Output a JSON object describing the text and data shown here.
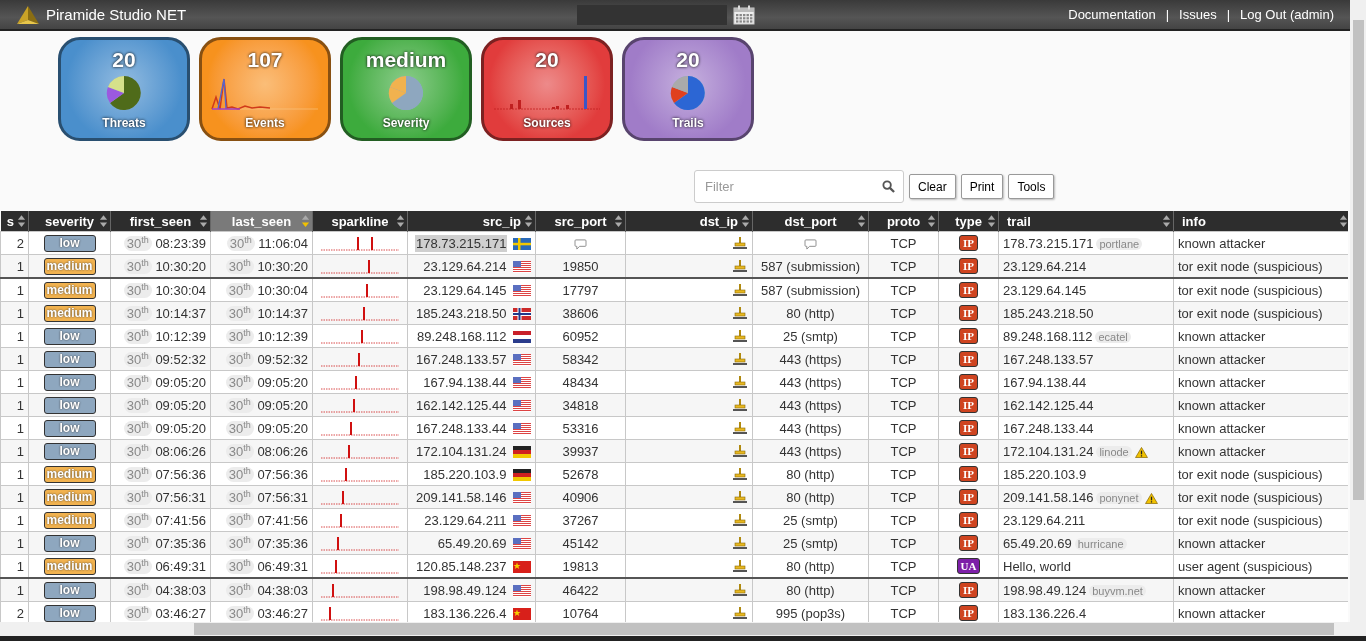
{
  "header": {
    "title": "Piramide Studio NET",
    "links": [
      "Documentation",
      "Issues",
      "Log Out (admin)"
    ],
    "separators": [
      "|",
      "|"
    ]
  },
  "cards": [
    {
      "value": "20",
      "label": "Threats",
      "color": "#4a8fcc",
      "kind": "pie"
    },
    {
      "value": "107",
      "label": "Events",
      "color": "#f7921e",
      "kind": "line"
    },
    {
      "value": "medium",
      "label": "Severity",
      "color": "#3dab3d",
      "kind": "pie"
    },
    {
      "value": "20",
      "label": "Sources",
      "color": "#e13c3c",
      "kind": "bar"
    },
    {
      "value": "20",
      "label": "Trails",
      "color": "#a07cc8",
      "kind": "pie"
    }
  ],
  "filter": {
    "placeholder": "Filter"
  },
  "buttons": [
    "Clear",
    "Print",
    "Tools"
  ],
  "table": {
    "columns": [
      {
        "label": "s",
        "sorted": false
      },
      {
        "label": "severity",
        "sorted": false
      },
      {
        "label": "first_seen",
        "sorted": false
      },
      {
        "label": "last_seen",
        "sorted": true
      },
      {
        "label": "sparkline",
        "sorted": false
      },
      {
        "label": "src_ip",
        "sorted": false
      },
      {
        "label": "src_port",
        "sorted": false
      },
      {
        "label": "dst_ip",
        "sorted": false
      },
      {
        "label": "dst_port",
        "sorted": false
      },
      {
        "label": "proto",
        "sorted": false
      },
      {
        "label": "type",
        "sorted": false
      },
      {
        "label": "trail",
        "sorted": false
      },
      {
        "label": "info",
        "sorted": false
      }
    ],
    "rows": [
      {
        "count": "2",
        "severity": {
          "label": "low",
          "color": "#8ea7bf"
        },
        "first_day": "30$^{th}$",
        "first_time": "08:23:39",
        "last_day": "30$^{th}$",
        "last_time": "11:06:04",
        "src_ip": "178.73.215.171",
        "src_ip_selected": true,
        "flag": {
          "kind": "se"
        },
        "proto": "TCP",
        "type": {
          "label": "IP",
          "color": "#cf4420"
        },
        "trail": "178.73.215.171",
        "tag": "portlane",
        "warning": false,
        "info": "known attacker",
        "divider_above": false
      },
      {
        "count": "1",
        "severity": {
          "label": "medium",
          "color": "#f1b24f"
        },
        "first_day": "30$^{th}$",
        "first_time": "10:30:20",
        "last_day": "30$^{th}$",
        "last_time": "10:30:20",
        "src_ip": "23.129.64.214",
        "src_ip_selected": false,
        "flag": {
          "kind": "us"
        },
        "src_port": "19850",
        "dst_port": "587 (submission)",
        "proto": "TCP",
        "type": {
          "label": "IP",
          "color": "#cf4420"
        },
        "trail": "23.129.64.214",
        "warning": false,
        "info": "tor exit node (suspicious)",
        "divider_above": false
      },
      {
        "count": "1",
        "severity": {
          "label": "medium",
          "color": "#f1b24f"
        },
        "first_day": "30$^{th}$",
        "first_time": "10:30:04",
        "last_day": "30$^{th}$",
        "last_time": "10:30:04",
        "src_ip": "23.129.64.145",
        "src_ip_selected": false,
        "flag": {
          "kind": "us"
        },
        "src_port": "17797",
        "dst_port": "587 (submission)",
        "proto": "TCP",
        "type": {
          "label": "IP",
          "color": "#cf4420"
        },
        "trail": "23.129.64.145",
        "warning": false,
        "info": "tor exit node (suspicious)",
        "divider_above": true
      },
      {
        "count": "1",
        "severity": {
          "label": "medium",
          "color": "#f1b24f"
        },
        "first_day": "30$^{th}$",
        "first_time": "10:14:37",
        "last_day": "30$^{th}$",
        "last_time": "10:14:37",
        "src_ip": "185.243.218.50",
        "src_ip_selected": false,
        "flag": {
          "kind": "no"
        },
        "src_port": "38606",
        "dst_port": "80 (http)",
        "proto": "TCP",
        "type": {
          "label": "IP",
          "color": "#cf4420"
        },
        "trail": "185.243.218.50",
        "warning": false,
        "info": "tor exit node (suspicious)",
        "divider_above": false
      },
      {
        "count": "1",
        "severity": {
          "label": "low",
          "color": "#8ea7bf"
        },
        "first_day": "30$^{th}$",
        "first_time": "10:12:39",
        "last_day": "30$^{th}$",
        "last_time": "10:12:39",
        "src_ip": "89.248.168.112",
        "src_ip_selected": false,
        "flag": {
          "kind": "nl"
        },
        "src_port": "60952",
        "dst_port": "25 (smtp)",
        "proto": "TCP",
        "type": {
          "label": "IP",
          "color": "#cf4420"
        },
        "trail": "89.248.168.112",
        "tag": "ecatel",
        "warning": false,
        "info": "known attacker",
        "divider_above": false
      },
      {
        "count": "1",
        "severity": {
          "label": "low",
          "color": "#8ea7bf"
        },
        "first_day": "30$^{th}$",
        "first_time": "09:52:32",
        "last_day": "30$^{th}$",
        "last_time": "09:52:32",
        "src_ip": "167.248.133.57",
        "src_ip_selected": false,
        "flag": {
          "kind": "us"
        },
        "src_port": "58342",
        "dst_port": "443 (https)",
        "proto": "TCP",
        "type": {
          "label": "IP",
          "color": "#cf4420"
        },
        "trail": "167.248.133.57",
        "warning": false,
        "info": "known attacker",
        "divider_above": false
      },
      {
        "count": "1",
        "severity": {
          "label": "low",
          "color": "#8ea7bf"
        },
        "first_day": "30$^{th}$",
        "first_time": "09:05:20",
        "last_day": "30$^{th}$",
        "last_time": "09:05:20",
        "src_ip": "167.94.138.44",
        "src_ip_selected": false,
        "flag": {
          "kind": "us"
        },
        "src_port": "48434",
        "dst_port": "443 (https)",
        "proto": "TCP",
        "type": {
          "label": "IP",
          "color": "#cf4420"
        },
        "trail": "167.94.138.44",
        "warning": false,
        "info": "known attacker",
        "divider_above": false
      },
      {
        "count": "1",
        "severity": {
          "label": "low",
          "color": "#8ea7bf"
        },
        "first_day": "30$^{th}$",
        "first_time": "09:05:20",
        "last_day": "30$^{th}$",
        "last_time": "09:05:20",
        "src_ip": "162.142.125.44",
        "src_ip_selected": false,
        "flag": {
          "kind": "us"
        },
        "src_port": "34818",
        "dst_port": "443 (https)",
        "proto": "TCP",
        "type": {
          "label": "IP",
          "color": "#cf4420"
        },
        "trail": "162.142.125.44",
        "warning": false,
        "info": "known attacker",
        "divider_above": false
      },
      {
        "count": "1",
        "severity": {
          "label": "low",
          "color": "#8ea7bf"
        },
        "first_day": "30$^{th}$",
        "first_time": "09:05:20",
        "last_day": "30$^{th}$",
        "last_time": "09:05:20",
        "src_ip": "167.248.133.44",
        "src_ip_selected": false,
        "flag": {
          "kind": "us"
        },
        "src_port": "53316",
        "dst_port": "443 (https)",
        "proto": "TCP",
        "type": {
          "label": "IP",
          "color": "#cf4420"
        },
        "trail": "167.248.133.44",
        "warning": false,
        "info": "known attacker",
        "divider_above": false
      },
      {
        "count": "1",
        "severity": {
          "label": "low",
          "color": "#8ea7bf"
        },
        "first_day": "30$^{th}$",
        "first_time": "08:06:26",
        "last_day": "30$^{th}$",
        "last_time": "08:06:26",
        "src_ip": "172.104.131.24",
        "src_ip_selected": false,
        "flag": {
          "kind": "de"
        },
        "src_port": "39937",
        "dst_port": "443 (https)",
        "proto": "TCP",
        "type": {
          "label": "IP",
          "color": "#cf4420"
        },
        "trail": "172.104.131.24",
        "tag": "linode",
        "warning": true,
        "info": "known attacker",
        "divider_above": false
      },
      {
        "count": "1",
        "severity": {
          "label": "medium",
          "color": "#f1b24f"
        },
        "first_day": "30$^{th}$",
        "first_time": "07:56:36",
        "last_day": "30$^{th}$",
        "last_time": "07:56:36",
        "src_ip": "185.220.103.9",
        "src_ip_selected": false,
        "flag": {
          "kind": "de"
        },
        "src_port": "52678",
        "dst_port": "80 (http)",
        "proto": "TCP",
        "type": {
          "label": "IP",
          "color": "#cf4420"
        },
        "trail": "185.220.103.9",
        "warning": false,
        "info": "tor exit node (suspicious)",
        "divider_above": false
      },
      {
        "count": "1",
        "severity": {
          "label": "medium",
          "color": "#f1b24f"
        },
        "first_day": "30$^{th}$",
        "first_time": "07:56:31",
        "last_day": "30$^{th}$",
        "last_time": "07:56:31",
        "src_ip": "209.141.58.146",
        "src_ip_selected": false,
        "flag": {
          "kind": "us"
        },
        "src_port": "40906",
        "dst_port": "80 (http)",
        "proto": "TCP",
        "type": {
          "label": "IP",
          "color": "#cf4420"
        },
        "trail": "209.141.58.146",
        "tag": "ponynet",
        "warning": true,
        "info": "tor exit node (suspicious)",
        "divider_above": false
      },
      {
        "count": "1",
        "severity": {
          "label": "medium",
          "color": "#f1b24f"
        },
        "first_day": "30$^{th}$",
        "first_time": "07:41:56",
        "last_day": "30$^{th}$",
        "last_time": "07:41:56",
        "src_ip": "23.129.64.211",
        "src_ip_selected": false,
        "flag": {
          "kind": "us"
        },
        "src_port": "37267",
        "dst_port": "25 (smtp)",
        "proto": "TCP",
        "type": {
          "label": "IP",
          "color": "#cf4420"
        },
        "trail": "23.129.64.211",
        "warning": false,
        "info": "tor exit node (suspicious)",
        "divider_above": false
      },
      {
        "count": "1",
        "severity": {
          "label": "low",
          "color": "#8ea7bf"
        },
        "first_day": "30$^{th}$",
        "first_time": "07:35:36",
        "last_day": "30$^{th}$",
        "last_time": "07:35:36",
        "src_ip": "65.49.20.69",
        "src_ip_selected": false,
        "flag": {
          "kind": "us"
        },
        "src_port": "45142",
        "dst_port": "25 (smtp)",
        "proto": "TCP",
        "type": {
          "label": "IP",
          "color": "#cf4420"
        },
        "trail": "65.49.20.69",
        "tag": "hurricane",
        "warning": false,
        "info": "known attacker",
        "divider_above": false
      },
      {
        "count": "1",
        "severity": {
          "label": "medium",
          "color": "#f1b24f"
        },
        "first_day": "30$^{th}$",
        "first_time": "06:49:31",
        "last_day": "30$^{th}$",
        "last_time": "06:49:31",
        "src_ip": "120.85.148.237",
        "src_ip_selected": false,
        "flag": {
          "kind": "cn"
        },
        "src_port": "19813",
        "dst_port": "80 (http)",
        "proto": "TCP",
        "type": {
          "label": "UA",
          "color": "#7d1fa8"
        },
        "trail": "Hello, world",
        "warning": false,
        "info": "user agent (suspicious)",
        "divider_above": false
      },
      {
        "count": "1",
        "severity": {
          "label": "low",
          "color": "#8ea7bf"
        },
        "first_day": "30$^{th}$",
        "first_time": "04:38:03",
        "last_day": "30$^{th}$",
        "last_time": "04:38:03",
        "src_ip": "198.98.49.124",
        "src_ip_selected": false,
        "flag": {
          "kind": "us"
        },
        "src_port": "46422",
        "dst_port": "80 (http)",
        "proto": "TCP",
        "type": {
          "label": "IP",
          "color": "#cf4420"
        },
        "trail": "198.98.49.124",
        "tag": "buyvm.net",
        "warning": false,
        "info": "known attacker",
        "divider_above": true
      },
      {
        "count": "2",
        "severity": {
          "label": "low",
          "color": "#8ea7bf"
        },
        "first_day": "30$^{th}$",
        "first_time": "03:46:27",
        "last_day": "30$^{th}$",
        "last_time": "03:46:27",
        "src_ip": "183.136.226.4",
        "src_ip_selected": false,
        "flag": {
          "kind": "cn"
        },
        "src_port": "10764",
        "dst_port": "995 (pop3s)",
        "proto": "TCP",
        "type": {
          "label": "IP",
          "color": "#cf4420"
        },
        "trail": "183.136.226.4",
        "warning": false,
        "info": "known attacker",
        "divider_above": false
      }
    ]
  }
}
